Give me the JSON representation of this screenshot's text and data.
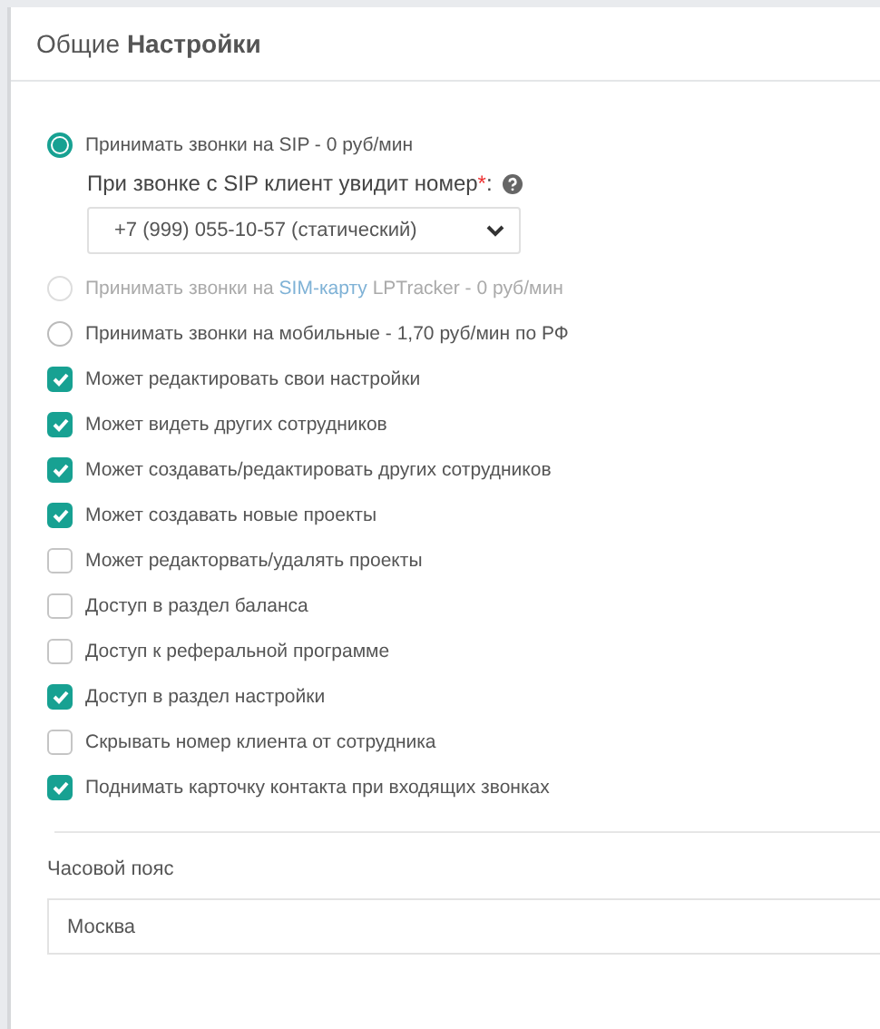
{
  "panel": {
    "title": "Общие **Настройки**"
  },
  "call_modes": [
    {
      "parts": [
        {
          "text": "Принимать звонки на SIP - 0 руб/мин",
          "link": false
        }
      ],
      "selected": true,
      "disabled": false
    },
    {
      "parts": [
        {
          "text": "Принимать звонки на ",
          "link": false
        },
        {
          "text": "SIM-карту",
          "link": true
        },
        {
          "text": " LPTracker - 0 руб/мин",
          "link": false
        }
      ],
      "selected": false,
      "disabled": true
    },
    {
      "parts": [
        {
          "text": "Принимать звонки на мобильные - 1,70 руб/мин по РФ",
          "link": false
        }
      ],
      "selected": false,
      "disabled": false
    }
  ],
  "caller_id": {
    "label": "При звонке с SIP клиент увидит номер",
    "required_mark": "*",
    "suffix": ":",
    "value": "+7 (999) 055-10-57 (статический)"
  },
  "permissions": [
    {
      "label": "Может редактировать свои настройки",
      "checked": true
    },
    {
      "label": "Может видеть других сотрудников",
      "checked": true
    },
    {
      "label": "Может создавать/редактировать других сотрудников",
      "checked": true
    },
    {
      "label": "Может создавать новые проекты",
      "checked": true
    },
    {
      "label": "Может редакторвать/удалять проекты",
      "checked": false
    },
    {
      "label": "Доступ в раздел баланса",
      "checked": false
    },
    {
      "label": "Доступ к реферальной программе",
      "checked": false
    },
    {
      "label": "Доступ в раздел настройки",
      "checked": true
    },
    {
      "label": "Скрывать номер клиента от сотрудника",
      "checked": false
    },
    {
      "label": "Поднимать карточку контакта при входящих звонках",
      "checked": true
    }
  ],
  "timezone": {
    "label": "Часовой пояс",
    "value": "Москва"
  }
}
